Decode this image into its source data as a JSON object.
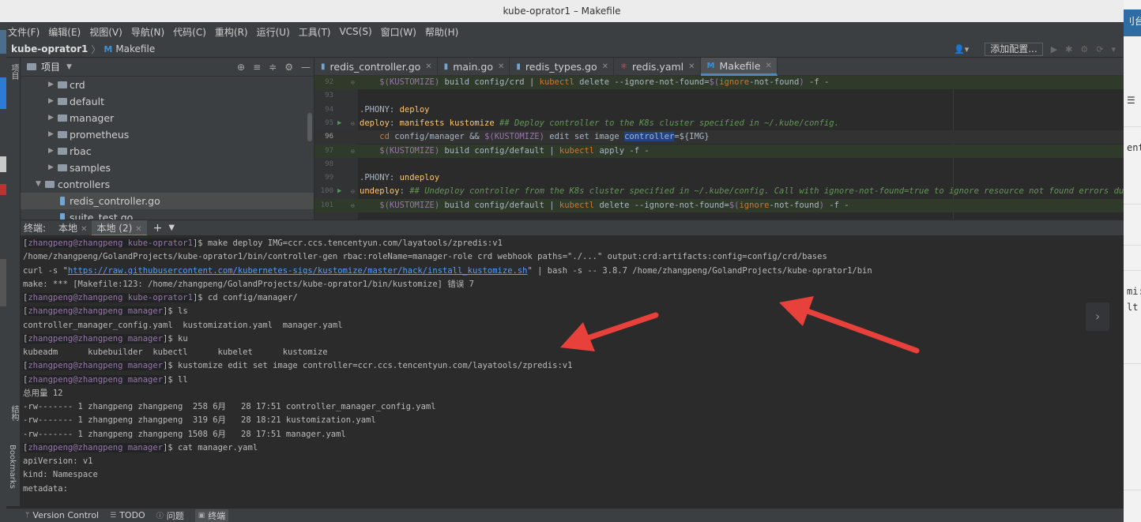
{
  "window": {
    "title": "kube-oprator1 – Makefile"
  },
  "menu": [
    "文件(F)",
    "编辑(E)",
    "视图(V)",
    "导航(N)",
    "代码(C)",
    "重构(R)",
    "运行(U)",
    "工具(T)",
    "VCS(S)",
    "窗口(W)",
    "帮助(H)"
  ],
  "navbar": {
    "project": "kube-oprator1",
    "separator": "〉",
    "file": "Makefile",
    "add_config": "添加配置..."
  },
  "side_tabs": {
    "project": "项目",
    "structure": "结构",
    "bookmarks": "Bookmarks"
  },
  "project_panel": {
    "title": "项目",
    "tree": [
      {
        "label": "crd"
      },
      {
        "label": "default"
      },
      {
        "label": "manager"
      },
      {
        "label": "prometheus"
      },
      {
        "label": "rbac"
      },
      {
        "label": "samples"
      },
      {
        "label": "controllers"
      },
      {
        "label": "redis_controller.go"
      },
      {
        "label": "suite_test.go"
      }
    ]
  },
  "editor_tabs": [
    {
      "label": "redis_controller.go",
      "icon": "go-file-icon"
    },
    {
      "label": "main.go",
      "icon": "go-file-icon"
    },
    {
      "label": "redis_types.go",
      "icon": "go-file-icon"
    },
    {
      "label": "redis.yaml",
      "icon": "yaml-file-icon"
    },
    {
      "label": "Makefile",
      "icon": "makefile-icon",
      "active": true
    }
  ],
  "editor": {
    "lines": [
      {
        "num": "92",
        "html": "    <span class=\"t-var\">$(KUSTOMIZE)</span> build config/crd | <span class=\"t-kw\">kubectl</span> delete --ignore-not-found=<span class=\"t-var\">$(</span><span class=\"t-kw\">ignore</span>-not-found<span class=\"t-var\">)</span> -f -"
      },
      {
        "num": "93",
        "html": ""
      },
      {
        "num": "94",
        "html": ".PHONY: <span class=\"t-target\">deploy</span>"
      },
      {
        "num": "95",
        "html": "<span class=\"t-target\">deploy</span>: <span class=\"t-target\">manifests kustomize</span> <span class=\"t-com\">## Deploy controller to the K8s cluster specified in ~/.kube/config.</span>"
      },
      {
        "num": "96",
        "html": "    <span class=\"t-kw\">cd</span> config/manager &amp;&amp; <span class=\"t-var\">$(KUSTOMIZE)</span> edit set image <span class=\"t-sel\">controller</span>=${IMG}"
      },
      {
        "num": "97",
        "html": "    <span class=\"t-var\">$(KUSTOMIZE)</span> build config/default | <span class=\"t-kw\">kubectl</span> apply -f -"
      },
      {
        "num": "98",
        "html": ""
      },
      {
        "num": "99",
        "html": ".PHONY: <span class=\"t-target\">undeploy</span>"
      },
      {
        "num": "100",
        "html": "<span class=\"t-target\">undeploy</span>: <span class=\"t-com\">## Undeploy controller from the K8s cluster specified in ~/.kube/config. Call with ignore-not-found=true to ignore resource not found errors dur</span>"
      },
      {
        "num": "101",
        "html": "    <span class=\"t-var\">$(KUSTOMIZE)</span> build config/default | <span class=\"t-kw\">kubectl</span> delete --ignore-not-found=<span class=\"t-var\">$(</span><span class=\"t-kw\">ignore</span>-not-found<span class=\"t-var\">)</span> -f -"
      }
    ]
  },
  "terminal_head": {
    "label": "终端:",
    "tabs": [
      "本地",
      "本地 (2)"
    ]
  },
  "terminal": {
    "lines": [
      {
        "user": "zhangpeng@zhangpeng",
        "dir": "kube-oprator1",
        "cmd": "make deploy IMG=ccr.ccs.tencentyun.com/layatools/zpredis:v1"
      },
      {
        "text": "/home/zhangpeng/GolandProjects/kube-oprator1/bin/controller-gen rbac:roleName=manager-role crd webhook paths=\"./...\" output:crd:artifacts:config=config/crd/bases"
      },
      {
        "pre": "curl -s \"",
        "link": "https://raw.githubusercontent.com/kubernetes-sigs/kustomize/master/hack/install_kustomize.sh",
        "post": "\" | bash -s -- 3.8.7 /home/zhangpeng/GolandProjects/kube-oprator1/bin"
      },
      {
        "text": "make: *** [Makefile:123: /home/zhangpeng/GolandProjects/kube-oprator1/bin/kustomize] 错误 7"
      },
      {
        "user": "zhangpeng@zhangpeng",
        "dir": "kube-oprator1",
        "cmd": "cd config/manager/"
      },
      {
        "user": "zhangpeng@zhangpeng",
        "dir": "manager",
        "cmd": "ls"
      },
      {
        "text": "controller_manager_config.yaml  kustomization.yaml  manager.yaml"
      },
      {
        "user": "zhangpeng@zhangpeng",
        "dir": "manager",
        "cmd": "ku"
      },
      {
        "text": "kubeadm      kubebuilder  kubectl      kubelet      kustomize"
      },
      {
        "user": "zhangpeng@zhangpeng",
        "dir": "manager",
        "cmd": "kustomize edit set image controller=ccr.ccs.tencentyun.com/layatools/zpredis:v1"
      },
      {
        "user": "zhangpeng@zhangpeng",
        "dir": "manager",
        "cmd": "ll"
      },
      {
        "text": "总用量 12"
      },
      {
        "text": "-rw------- 1 zhangpeng zhangpeng  258 6月   28 17:51 controller_manager_config.yaml"
      },
      {
        "text": "-rw------- 1 zhangpeng zhangpeng  319 6月   28 18:21 kustomization.yaml"
      },
      {
        "text": "-rw------- 1 zhangpeng zhangpeng 1508 6月   28 17:51 manager.yaml"
      },
      {
        "user": "zhangpeng@zhangpeng",
        "dir": "manager",
        "cmd": "cat manager.yaml"
      },
      {
        "text": "apiVersion: v1"
      },
      {
        "text": "kind: Namespace"
      },
      {
        "text": "metadata:"
      }
    ]
  },
  "statusbar": [
    {
      "label": "Version Control",
      "icon": "branch-icon"
    },
    {
      "label": "TODO",
      "icon": "list-icon"
    },
    {
      "label": "问题",
      "icon": "info-icon"
    },
    {
      "label": "终端",
      "icon": "terminal-icon",
      "active": true
    }
  ],
  "outer_window": {
    "top_text": "刂台",
    "frag1": "ent",
    "frag2": "mi:",
    "frag3": "lt"
  },
  "annotation_color": "#e8403a"
}
